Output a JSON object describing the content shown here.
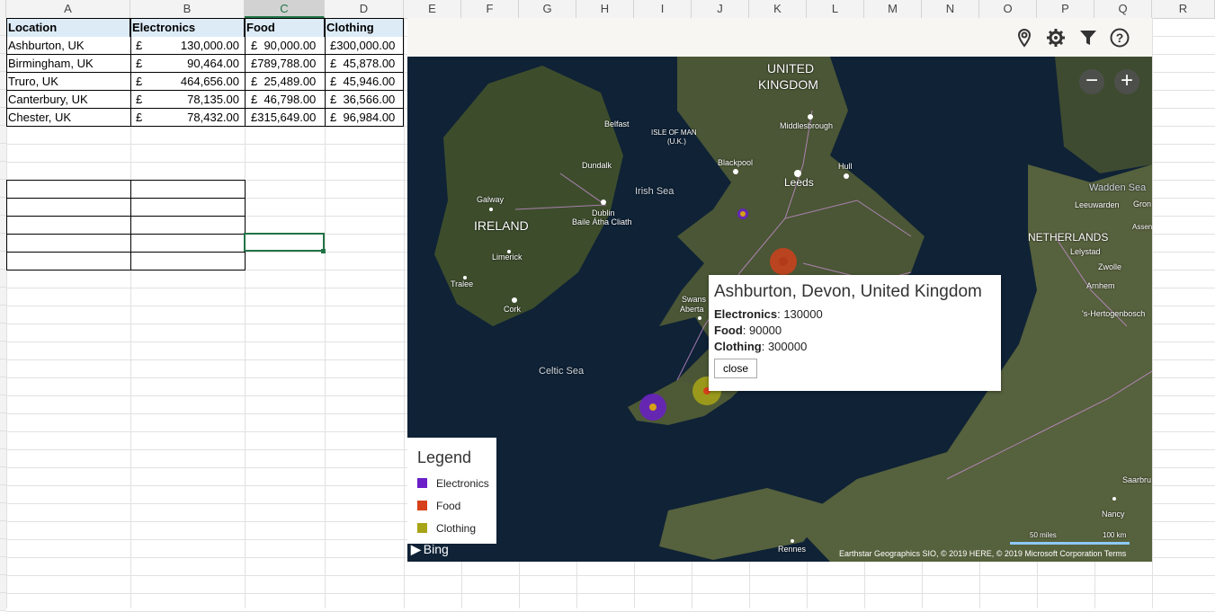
{
  "columns": [
    "A",
    "B",
    "C",
    "D",
    "E",
    "F",
    "G",
    "H",
    "I",
    "J",
    "K",
    "L",
    "M",
    "N",
    "O",
    "P",
    "Q",
    "R"
  ],
  "selected_column": "C",
  "table": {
    "headers": [
      "Location",
      "Electronics",
      "Food",
      "Clothing"
    ],
    "rows": [
      {
        "location": "Ashburton, UK",
        "cur1": "£",
        "electronics": "130,000.00",
        "food": "£  90,000.00",
        "clothing": "£300,000.00"
      },
      {
        "location": "Birmingham, UK",
        "cur1": "£",
        "electronics": "90,464.00",
        "food": "£789,788.00",
        "clothing": "£  45,878.00"
      },
      {
        "location": "Truro, UK",
        "cur1": "£",
        "electronics": "464,656.00",
        "food": "£  25,489.00",
        "clothing": "£  45,946.00"
      },
      {
        "location": "Canterbury, UK",
        "cur1": "£",
        "electronics": "78,135.00",
        "food": "£  46,798.00",
        "clothing": "£  36,566.00"
      },
      {
        "location": "Chester, UK",
        "cur1": "£",
        "electronics": "78,432.00",
        "food": "£315,649.00",
        "clothing": "£  96,984.00"
      }
    ]
  },
  "map": {
    "toolbar_icons": [
      "location-pin-icon",
      "gear-icon",
      "filter-icon",
      "help-icon"
    ],
    "zoom_out": "−",
    "zoom_in": "+",
    "labels": {
      "uk": "UNITED",
      "uk2": "KINGDOM",
      "ireland": "IRELAND",
      "netherlands": "NETHERLANDS",
      "irish_sea": "Irish Sea",
      "celtic_sea": "Celtic Sea",
      "wadden_sea": "Wadden Sea",
      "belfast": "Belfast",
      "isle_of_man": "ISLE OF MAN",
      "isle_of_man2": "(U.K.)",
      "dundalk": "Dundalk",
      "galway": "Galway",
      "dublin": "Dublin",
      "dublin2": "Baile Átha Cliath",
      "limerick": "Limerick",
      "tralee": "Tralee",
      "cork": "Cork",
      "middlesbrough": "Middlesbrough",
      "blackpool": "Blackpool",
      "leeds": "Leeds",
      "hull": "Hull",
      "swansea": "Swans",
      "aberta": "Aberta",
      "leeuwarden": "Leeuwarden",
      "gron": "Gron",
      "assen": "Assen",
      "lelystad": "Lelystad",
      "zwolle": "Zwolle",
      "arnhem": "Arnhem",
      "hertogenbosch": "'s-Hertogenbosch",
      "saarbru": "Saarbru",
      "nancy": "Nancy",
      "rennes": "Rennes"
    },
    "popup": {
      "title": "Ashburton, Devon, United Kingdom",
      "k1": "Electronics",
      "v1": ": 130000",
      "k2": "Food",
      "v2": ": 90000",
      "k3": "Clothing",
      "v3": ": 300000",
      "close": "close"
    },
    "legend": {
      "title": "Legend",
      "items": [
        {
          "label": "Electronics",
          "color": "#6a1fc8"
        },
        {
          "label": "Food",
          "color": "#d6401a"
        },
        {
          "label": "Clothing",
          "color": "#a8a418"
        }
      ]
    },
    "bing": "Bing",
    "attribution": "Earthstar Geographics SIO, © 2019 HERE, © 2019 Microsoft Corporation  Terms",
    "scale_miles": "50 miles",
    "scale_km": "100 km"
  },
  "colors": {
    "accent": "#217346",
    "header_fill": "#ddebf7"
  }
}
